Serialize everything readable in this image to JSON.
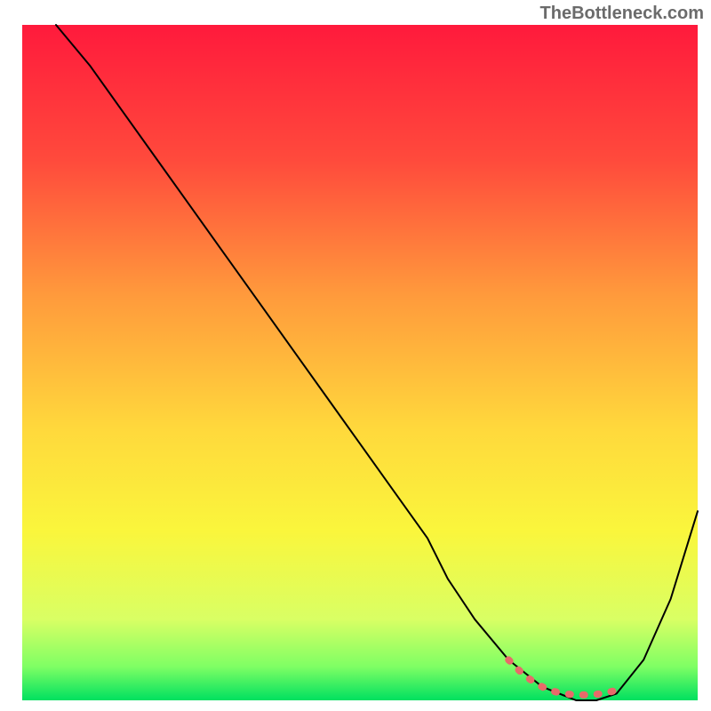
{
  "watermark": "TheBottleneck.com",
  "chart_data": {
    "type": "area",
    "title": "",
    "xlabel": "",
    "ylabel": "",
    "xlim": [
      0,
      100
    ],
    "ylim": [
      0,
      100
    ],
    "gradient_background": {
      "stops": [
        {
          "offset": 0.0,
          "color": "#ff1a3c"
        },
        {
          "offset": 0.2,
          "color": "#ff4a3c"
        },
        {
          "offset": 0.4,
          "color": "#ff9a3c"
        },
        {
          "offset": 0.6,
          "color": "#ffd93c"
        },
        {
          "offset": 0.75,
          "color": "#faf63c"
        },
        {
          "offset": 0.88,
          "color": "#d9ff64"
        },
        {
          "offset": 0.95,
          "color": "#7fff64"
        },
        {
          "offset": 1.0,
          "color": "#00e060"
        }
      ]
    },
    "series": [
      {
        "name": "bottleneck-curve",
        "color": "#000000",
        "x": [
          5,
          10,
          15,
          20,
          25,
          30,
          35,
          40,
          45,
          50,
          55,
          60,
          63,
          67,
          72,
          77,
          82,
          85,
          88,
          92,
          96,
          100
        ],
        "y": [
          100,
          94,
          87,
          80,
          73,
          66,
          59,
          52,
          45,
          38,
          31,
          24,
          18,
          12,
          6,
          2,
          0,
          0,
          1,
          6,
          15,
          28
        ]
      },
      {
        "name": "optimal-region-marker",
        "color": "#e86a6a",
        "thick": true,
        "x": [
          72,
          74,
          76,
          78,
          80,
          82,
          84,
          86,
          88
        ],
        "y": [
          6,
          4,
          2.5,
          1.5,
          1,
          0.8,
          0.8,
          1,
          1.5
        ]
      }
    ]
  }
}
